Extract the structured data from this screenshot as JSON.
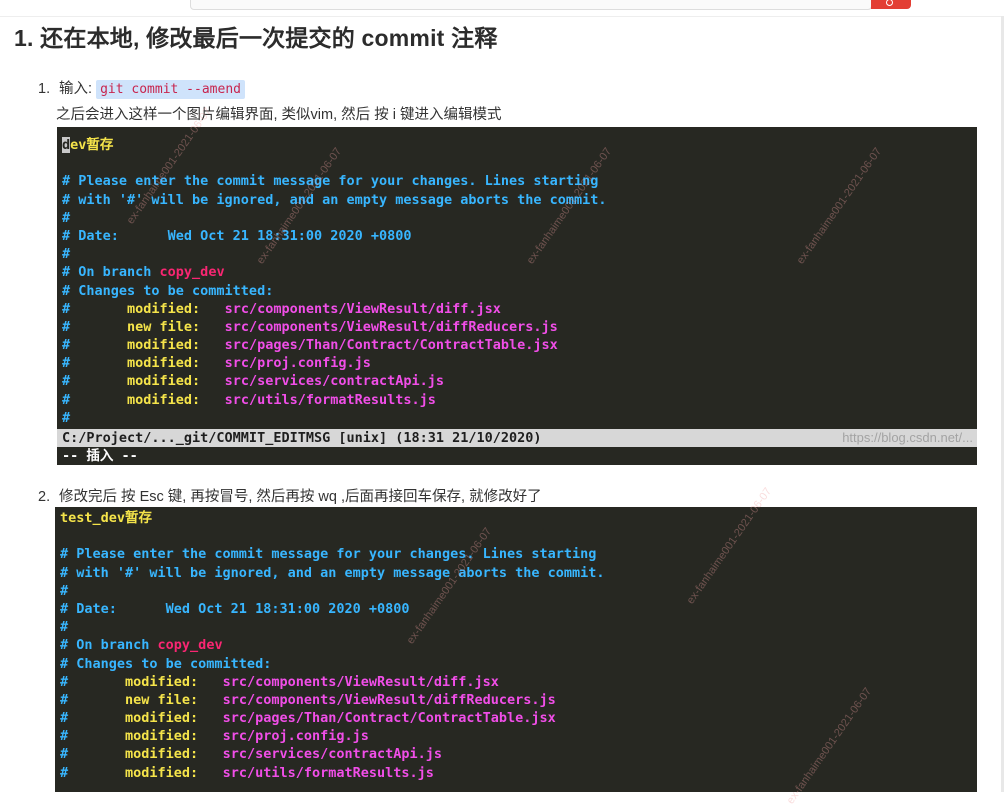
{
  "heading": "1. 还在本地, 修改最后一次提交的 commit 注释",
  "step1": {
    "number": "1.",
    "label": "输入:",
    "code": "git commit --amend",
    "description": "之后会进入这样一个图片编辑界面, 类似vim, 然后 按 i 键进入编辑模式"
  },
  "terminal1": {
    "first_char": "d",
    "first_rest": "ev暂存",
    "lines": [
      {
        "text": "",
        "cls": "c-cmt"
      },
      {
        "text": "# Please enter the commit message for your changes. Lines starting",
        "cls": "c-cmt"
      },
      {
        "text": "# with '#' will be ignored, and an empty message aborts the commit.",
        "cls": "c-cmt"
      },
      {
        "text": "#",
        "cls": "c-cmt"
      },
      {
        "text": "# Date:      Wed Oct 21 18:31:00 2020 +0800",
        "cls": "c-cmt"
      },
      {
        "text": "#",
        "cls": "c-cmt"
      }
    ],
    "branch_prefix": "# On branch ",
    "branch_name": "copy_dev",
    "changes_header": "# Changes to be committed:",
    "files": [
      {
        "status": "modified:",
        "path": "src/components/ViewResult/diff.jsx"
      },
      {
        "status": "new file:",
        "path": "src/components/ViewResult/diffReducers.js"
      },
      {
        "status": "modified:",
        "path": "src/pages/Than/Contract/ContractTable.jsx"
      },
      {
        "status": "modified:",
        "path": "src/proj.config.js"
      },
      {
        "status": "modified:",
        "path": "src/services/contractApi.js"
      },
      {
        "status": "modified:",
        "path": "src/utils/formatResults.js"
      }
    ],
    "trailing": "#",
    "status_bar": "C:/Project/..._git/COMMIT_EDITMSG [unix] (18:31 21/10/2020)",
    "mode": "-- 插入 --",
    "watermark": "https://blog.csdn.net/..."
  },
  "step2": {
    "number": "2.",
    "text": "修改完后 按 Esc 键, 再按冒号, 然后再按 wq ,后面再接回车保存, 就修改好了"
  },
  "terminal2": {
    "first_line": "test_dev暂存",
    "lines": [
      {
        "text": "",
        "cls": "c-cmt"
      },
      {
        "text": "# Please enter the commit message for your changes. Lines starting",
        "cls": "c-cmt"
      },
      {
        "text": "# with '#' will be ignored, and an empty message aborts the commit.",
        "cls": "c-cmt"
      },
      {
        "text": "#",
        "cls": "c-cmt"
      },
      {
        "text": "# Date:      Wed Oct 21 18:31:00 2020 +0800",
        "cls": "c-cmt"
      },
      {
        "text": "#",
        "cls": "c-cmt"
      }
    ],
    "branch_prefix": "# On branch ",
    "branch_name": "copy_dev",
    "changes_header": "# Changes to be committed:",
    "files": [
      {
        "status": "modified:",
        "path": "src/components/ViewResult/diff.jsx"
      },
      {
        "status": "new file:",
        "path": "src/components/ViewResult/diffReducers.js"
      },
      {
        "status": "modified:",
        "path": "src/pages/Than/Contract/ContractTable.jsx"
      },
      {
        "status": "modified:",
        "path": "src/proj.config.js"
      },
      {
        "status": "modified:",
        "path": "src/services/contractApi.js"
      },
      {
        "status": "modified:",
        "path": "src/utils/formatResults.js"
      }
    ]
  },
  "colors": {
    "terminal_bg": "#272822",
    "comment": "#38b6ff",
    "branch": "#f92672",
    "file": "#f14ee8",
    "title": "#f5e44a",
    "search_button": "#e33e33"
  }
}
